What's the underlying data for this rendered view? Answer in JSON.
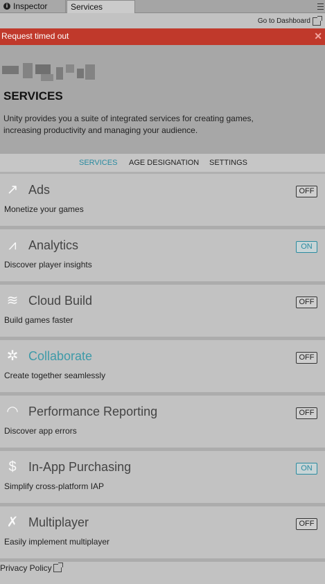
{
  "tabs": {
    "inspector": "Inspector",
    "services": "Services"
  },
  "toolbar": {
    "dashboard_link": "Go to Dashboard"
  },
  "error": {
    "message": "Request timed out",
    "close_glyph": "✕"
  },
  "header": {
    "title": "SERVICES",
    "description": "Unity provides you a suite of integrated services for creating games, increasing productivity and managing your audience."
  },
  "nav": {
    "services": "SERVICES",
    "age_designation": "AGE DESIGNATION",
    "settings": "SETTINGS",
    "active": "SERVICES"
  },
  "services": [
    {
      "name": "Ads",
      "description": "Monetize your games",
      "toggle": "OFF",
      "icon": "ads-icon",
      "glyph": "↗"
    },
    {
      "name": "Analytics",
      "description": "Discover player insights",
      "toggle": "ON",
      "icon": "analytics-icon",
      "glyph": "⩘"
    },
    {
      "name": "Cloud Build",
      "description": "Build games faster",
      "toggle": "OFF",
      "icon": "cloud-build-icon",
      "glyph": "≋"
    },
    {
      "name": "Collaborate",
      "description": "Create together seamlessly",
      "toggle": "OFF",
      "icon": "collaborate-icon",
      "glyph": "✲"
    },
    {
      "name": "Performance Reporting",
      "description": "Discover app errors",
      "toggle": "OFF",
      "icon": "performance-reporting-icon",
      "glyph": "◠"
    },
    {
      "name": "In-App Purchasing",
      "description": "Simplify cross-platform IAP",
      "toggle": "ON",
      "icon": "in-app-purchasing-icon",
      "glyph": "$"
    },
    {
      "name": "Multiplayer",
      "description": "Easily implement multiplayer",
      "toggle": "OFF",
      "icon": "multiplayer-icon",
      "glyph": "✗"
    }
  ],
  "footer": {
    "privacy_policy": "Privacy Policy"
  },
  "colors": {
    "error_banner": "#c0392b",
    "accent": "#2a8ba0"
  }
}
